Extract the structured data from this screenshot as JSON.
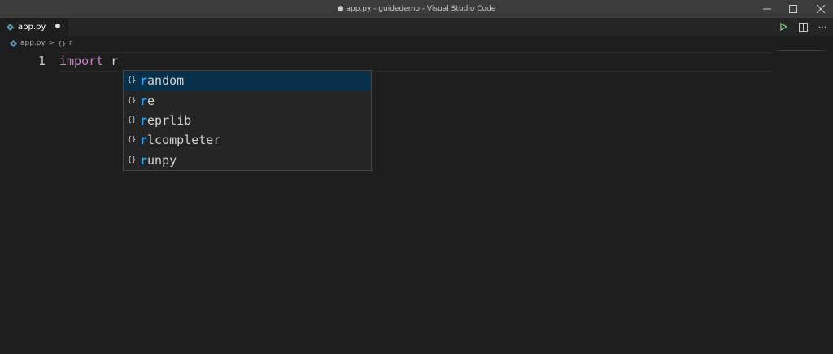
{
  "window": {
    "title": "● app.py - guidedemo - Visual Studio Code"
  },
  "tab": {
    "label": "app.py",
    "dirty": true
  },
  "tab_actions": {
    "run_icon": "play-icon",
    "split_icon": "split-editor-icon",
    "more_label": "···"
  },
  "breadcrumb": {
    "file": "app.py",
    "separator": ">",
    "symbol_icon": "{}",
    "symbol": "r"
  },
  "editor": {
    "line_number": "1",
    "keyword": "import",
    "space": " ",
    "identifier": "r"
  },
  "suggestions": [
    {
      "icon": "{}",
      "match": "r",
      "rest": "andom",
      "focused": true
    },
    {
      "icon": "{}",
      "match": "r",
      "rest": "e",
      "focused": false
    },
    {
      "icon": "{}",
      "match": "r",
      "rest": "eprlib",
      "focused": false
    },
    {
      "icon": "{}",
      "match": "r",
      "rest": "lcompleter",
      "focused": false
    },
    {
      "icon": "{}",
      "match": "r",
      "rest": "unpy",
      "focused": false
    }
  ],
  "colors": {
    "editor_bg": "#1e1e1e",
    "titlebar_bg": "#3c3c3c",
    "keyword": "#c586c0",
    "match_highlight": "#18a3ff",
    "focused_row": "#062f4a"
  }
}
